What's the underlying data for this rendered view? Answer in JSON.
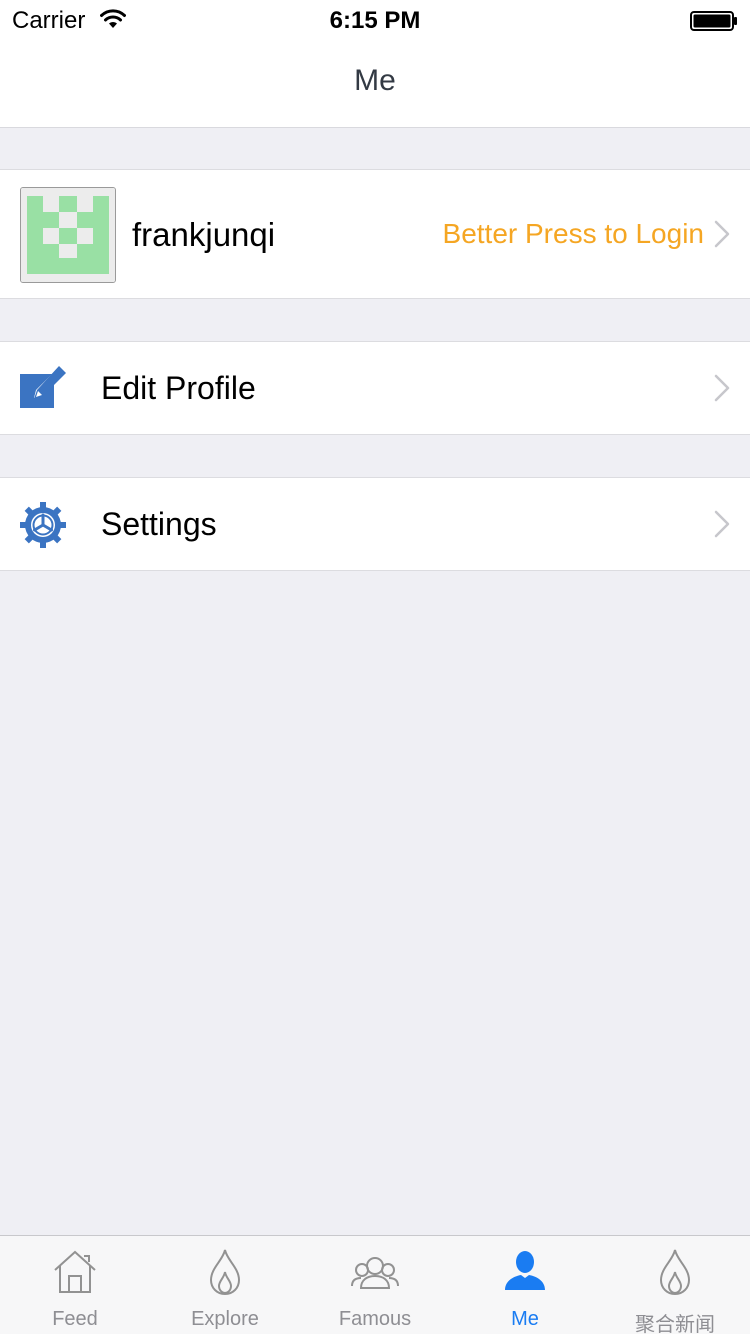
{
  "status_bar": {
    "carrier": "Carrier",
    "time": "6:15 PM"
  },
  "nav": {
    "title": "Me"
  },
  "profile": {
    "username": "frankjunqi",
    "login_hint": "Better Press to Login",
    "avatar_icon": "identicon-avatar",
    "login_hint_color": "#f5a623"
  },
  "menu": {
    "items": [
      {
        "label": "Edit Profile",
        "icon": "edit-icon"
      },
      {
        "label": "Settings",
        "icon": "gear-icon"
      }
    ]
  },
  "tab_bar": {
    "active_color": "#1a7cf2",
    "tabs": [
      {
        "label": "Feed",
        "icon": "home-icon",
        "active": false
      },
      {
        "label": "Explore",
        "icon": "flame-icon",
        "active": false
      },
      {
        "label": "Famous",
        "icon": "people-icon",
        "active": false
      },
      {
        "label": "Me",
        "icon": "person-icon",
        "active": true
      },
      {
        "label": "聚合新闻",
        "icon": "flame-icon",
        "active": false
      }
    ]
  }
}
